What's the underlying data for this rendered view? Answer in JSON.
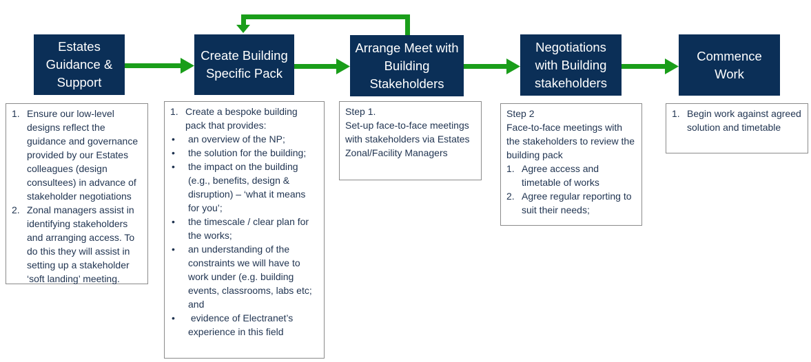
{
  "colors": {
    "step_fill": "#0b2f57",
    "arrow": "#1a9e1a",
    "text": "#1f3350"
  },
  "steps": [
    {
      "label": "Estates Guidance & Support"
    },
    {
      "label": "Create Building Specific Pack"
    },
    {
      "label": "Arrange Meet with Building Stakeholders"
    },
    {
      "label": "Negotiations with Building stakeholders"
    },
    {
      "label": "Commence Work"
    }
  ],
  "notes": {
    "estates": {
      "items": [
        {
          "marker": "1.",
          "text": "Ensure our low-level designs reflect the guidance and governance provided by our Estates colleagues (design consultees) in advance of stakeholder negotiations"
        },
        {
          "marker": "2.",
          "text": "Zonal managers assist in identifying stakeholders and arranging access. To do this they will assist in setting up a stakeholder ‘soft landing’ meeting."
        }
      ]
    },
    "pack": {
      "intro_marker": "1.",
      "intro": "Create a bespoke building pack that provides:",
      "bullets": [
        "an overview of the NP;",
        "the solution for the building;",
        "the impact on the building (e.g., benefits, design & disruption) – ‘what it means for you’;",
        "the timescale / clear plan for the works;",
        "an understanding of the constraints we will have to work under (e.g. building events, classrooms, labs etc; and",
        " evidence of Electranet’s experience in this field"
      ]
    },
    "arrange": {
      "heading": "Step 1.",
      "text": "Set-up face-to-face meetings with stakeholders via Estates Zonal/Facility Managers"
    },
    "negotiate": {
      "heading": "Step 2",
      "text": "Face-to-face meetings with the stakeholders to review the building pack",
      "items": [
        {
          "marker": "1.",
          "text": "Agree access and timetable of works"
        },
        {
          "marker": "2.",
          "text": "Agree regular reporting to suit their needs;"
        }
      ]
    },
    "commence": {
      "items": [
        {
          "marker": "1.",
          "text": "Begin work against agreed solution and timetable"
        }
      ]
    }
  }
}
